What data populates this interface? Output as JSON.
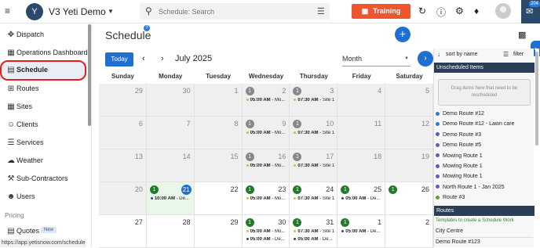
{
  "topbar": {
    "app_name": "V3 Yeti Demo",
    "logo_text": "Y",
    "search_placeholder": "Schedule: Search",
    "training_label": "Training",
    "chat_badge": "204"
  },
  "sidebar": {
    "items": [
      {
        "label": "Dispatch",
        "icon": "move-icon"
      },
      {
        "label": "Operations Dashboard",
        "icon": "dashboard-icon"
      },
      {
        "label": "Schedule",
        "icon": "calendar-icon",
        "active": true
      },
      {
        "label": "Routes",
        "icon": "routes-icon"
      },
      {
        "label": "Sites",
        "icon": "building-icon"
      },
      {
        "label": "Clients",
        "icon": "clients-icon"
      },
      {
        "label": "Services",
        "icon": "services-icon"
      },
      {
        "label": "Weather",
        "icon": "weather-icon"
      },
      {
        "label": "Sub-Contractors",
        "icon": "contractors-icon"
      },
      {
        "label": "Users",
        "icon": "users-icon"
      }
    ],
    "section_label": "Pricing",
    "quotes_label": "Quotes",
    "quotes_badge": "New",
    "status_url": "https://app.yetisnow.com/schedule"
  },
  "main": {
    "title": "Schedule",
    "help_mark": "?",
    "today_label": "Today",
    "month_label": "July 2025",
    "view_value": "Month"
  },
  "calendar": {
    "weekdays": [
      "Sunday",
      "Monday",
      "Tuesday",
      "Wednesday",
      "Thursday",
      "Friday",
      "Saturday"
    ],
    "weeks": [
      [
        {
          "day": "29",
          "other": true
        },
        {
          "day": "30",
          "other": true
        },
        {
          "day": "1",
          "other": true
        },
        {
          "day": "2",
          "other": true,
          "count": "1",
          "events": [
            {
              "time": "05:00 AM",
              "text": " - Mo...",
              "color": "#b9c93a"
            }
          ]
        },
        {
          "day": "3",
          "other": true,
          "count": "1",
          "events": [
            {
              "time": "07:30 AM",
              "text": " - Site 1",
              "color": "#b9c93a"
            }
          ]
        },
        {
          "day": "4",
          "other": true
        },
        {
          "day": "5",
          "other": true
        }
      ],
      [
        {
          "day": "6",
          "other": true
        },
        {
          "day": "7",
          "other": true
        },
        {
          "day": "8",
          "other": true
        },
        {
          "day": "9",
          "other": true,
          "count": "1",
          "events": [
            {
              "time": "05:00 AM",
              "text": " - Mo...",
              "color": "#b9c93a"
            }
          ]
        },
        {
          "day": "10",
          "other": true,
          "count": "1",
          "events": [
            {
              "time": "07:30 AM",
              "text": " - Site 1",
              "color": "#b9c93a"
            }
          ]
        },
        {
          "day": "11",
          "other": true
        },
        {
          "day": "12",
          "other": true
        }
      ],
      [
        {
          "day": "13",
          "other": true
        },
        {
          "day": "14",
          "other": true
        },
        {
          "day": "15",
          "other": true
        },
        {
          "day": "16",
          "other": true,
          "count": "1",
          "events": [
            {
              "time": "05:00 AM",
              "text": " - Mo...",
              "color": "#b9c93a"
            }
          ]
        },
        {
          "day": "17",
          "other": true,
          "count": "1",
          "events": [
            {
              "time": "07:30 AM",
              "text": " - Site 1",
              "color": "#b9c93a"
            }
          ]
        },
        {
          "day": "18",
          "other": true
        },
        {
          "day": "19",
          "other": true
        }
      ],
      [
        {
          "day": "20",
          "other": true
        },
        {
          "day": "21",
          "today": true,
          "count": "1",
          "green": true,
          "events": [
            {
              "time": "10:00 AM",
              "text": " - De...",
              "color": "#2b4a6b"
            }
          ]
        },
        {
          "day": "22"
        },
        {
          "day": "23",
          "count": "1",
          "green": true,
          "events": [
            {
              "time": "05:00 AM",
              "text": " - Mo...",
              "color": "#b9c93a"
            }
          ]
        },
        {
          "day": "24",
          "count": "1",
          "green": true,
          "events": [
            {
              "time": "07:30 AM",
              "text": " - Site 1",
              "color": "#b9c93a"
            }
          ]
        },
        {
          "day": "25",
          "count": "1",
          "green": true,
          "events": [
            {
              "time": "05:00 AM",
              "text": " - De...",
              "color": "#2b4a6b"
            }
          ]
        },
        {
          "day": "26",
          "count": "1",
          "green": true,
          "events": []
        }
      ],
      [
        {
          "day": "27"
        },
        {
          "day": "28"
        },
        {
          "day": "29"
        },
        {
          "day": "30",
          "count": "1",
          "green": true,
          "events": [
            {
              "time": "05:00 AM",
              "text": " - Mo...",
              "color": "#b9c93a"
            },
            {
              "time": "05:00 AM",
              "text": " - De...",
              "color": "#2b4a6b"
            }
          ]
        },
        {
          "day": "31",
          "count": "1",
          "green": true,
          "events": [
            {
              "time": "07:30 AM",
              "text": " - Site 1",
              "color": "#b9c93a"
            },
            {
              "time": "05:00 AM",
              "text": " - De...",
              "color": "#2b4a6b"
            }
          ]
        },
        {
          "day": "1",
          "count": "1",
          "green": true,
          "events": [
            {
              "time": "05:00 AM",
              "text": " - De...",
              "color": "#2b4a6b"
            }
          ]
        },
        {
          "day": "2"
        }
      ]
    ]
  },
  "panel": {
    "sort_label": "sort by name",
    "filter_label": "filter",
    "unscheduled_title": "Unscheduled Items",
    "dropzone_text": "Drag items here that need to be rescheduled",
    "items": [
      {
        "label": "Demo Route #12",
        "color": "#2e7bd6"
      },
      {
        "label": "Demo Route #12 - Lawn care",
        "color": "#2e7bd6"
      },
      {
        "label": "Demo Route #3",
        "color": "#5b5fb5"
      },
      {
        "label": "Demo Route #5",
        "color": "#5b5fb5"
      },
      {
        "label": "Mowing Route 1",
        "color": "#5b5fb5"
      },
      {
        "label": "Mowing Route 1",
        "color": "#5b5fb5"
      },
      {
        "label": "Mowing Route 1",
        "color": "#5b5fb5"
      },
      {
        "label": "North Route 1 - Jan 2025",
        "color": "#5b5fb5"
      },
      {
        "label": "Route #3",
        "color": "#6a9a3a"
      }
    ],
    "routes_title": "Routes",
    "routes_hint": "Templates to create a Schedule Work",
    "routes": [
      "City Centre",
      "Demo Route #123"
    ]
  }
}
